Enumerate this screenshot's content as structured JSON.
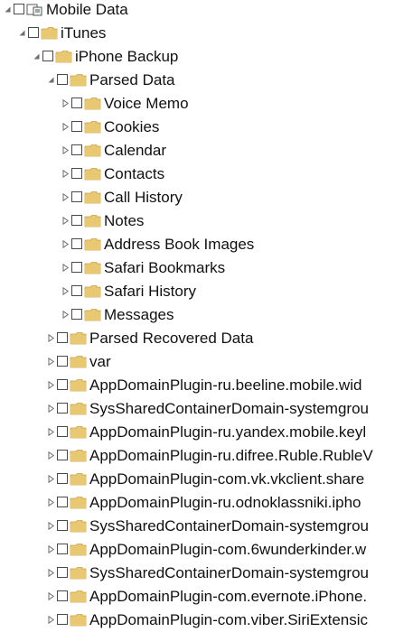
{
  "tree": {
    "nodes": [
      {
        "label": "Mobile Data",
        "depth": 0,
        "expander": "collapse",
        "icon": "device-folder-icon"
      },
      {
        "label": "iTunes",
        "depth": 1,
        "expander": "collapse",
        "icon": "folder-icon"
      },
      {
        "label": "iPhone Backup",
        "depth": 2,
        "expander": "collapse",
        "icon": "folder-icon"
      },
      {
        "label": "Parsed Data",
        "depth": 3,
        "expander": "collapse",
        "icon": "folder-icon"
      },
      {
        "label": "Voice Memo",
        "depth": 4,
        "expander": "expand",
        "icon": "folder-icon"
      },
      {
        "label": "Cookies",
        "depth": 4,
        "expander": "expand",
        "icon": "folder-icon"
      },
      {
        "label": "Calendar",
        "depth": 4,
        "expander": "expand",
        "icon": "folder-icon"
      },
      {
        "label": "Contacts",
        "depth": 4,
        "expander": "expand",
        "icon": "folder-icon"
      },
      {
        "label": "Call History",
        "depth": 4,
        "expander": "expand",
        "icon": "folder-icon"
      },
      {
        "label": "Notes",
        "depth": 4,
        "expander": "expand",
        "icon": "folder-icon"
      },
      {
        "label": "Address Book Images",
        "depth": 4,
        "expander": "expand",
        "icon": "folder-icon"
      },
      {
        "label": "Safari Bookmarks",
        "depth": 4,
        "expander": "expand",
        "icon": "folder-icon"
      },
      {
        "label": "Safari History",
        "depth": 4,
        "expander": "expand",
        "icon": "folder-icon"
      },
      {
        "label": "Messages",
        "depth": 4,
        "expander": "expand",
        "icon": "folder-icon"
      },
      {
        "label": "Parsed Recovered Data",
        "depth": 3,
        "expander": "expand",
        "icon": "folder-icon"
      },
      {
        "label": "var",
        "depth": 3,
        "expander": "expand",
        "icon": "folder-icon"
      },
      {
        "label": "AppDomainPlugin-ru.beeline.mobile.wid",
        "depth": 3,
        "expander": "expand",
        "icon": "folder-icon"
      },
      {
        "label": "SysSharedContainerDomain-systemgrou",
        "depth": 3,
        "expander": "expand",
        "icon": "folder-icon"
      },
      {
        "label": "AppDomainPlugin-ru.yandex.mobile.keyl",
        "depth": 3,
        "expander": "expand",
        "icon": "folder-icon"
      },
      {
        "label": "AppDomainPlugin-ru.difree.Ruble.RubleV",
        "depth": 3,
        "expander": "expand",
        "icon": "folder-icon"
      },
      {
        "label": "AppDomainPlugin-com.vk.vkclient.share",
        "depth": 3,
        "expander": "expand",
        "icon": "folder-icon"
      },
      {
        "label": "AppDomainPlugin-ru.odnoklassniki.ipho",
        "depth": 3,
        "expander": "expand",
        "icon": "folder-icon"
      },
      {
        "label": "SysSharedContainerDomain-systemgrou",
        "depth": 3,
        "expander": "expand",
        "icon": "folder-icon"
      },
      {
        "label": "AppDomainPlugin-com.6wunderkinder.w",
        "depth": 3,
        "expander": "expand",
        "icon": "folder-icon"
      },
      {
        "label": "SysSharedContainerDomain-systemgrou",
        "depth": 3,
        "expander": "expand",
        "icon": "folder-icon"
      },
      {
        "label": "AppDomainPlugin-com.evernote.iPhone.",
        "depth": 3,
        "expander": "expand",
        "icon": "folder-icon"
      },
      {
        "label": "AppDomainPlugin-com.viber.SiriExtensic",
        "depth": 3,
        "expander": "expand",
        "icon": "folder-icon"
      }
    ]
  },
  "colors": {
    "folder": "#e8c872",
    "folder_dark": "#c9a24a",
    "expander": "#6e6e6e",
    "text": "#111111"
  }
}
